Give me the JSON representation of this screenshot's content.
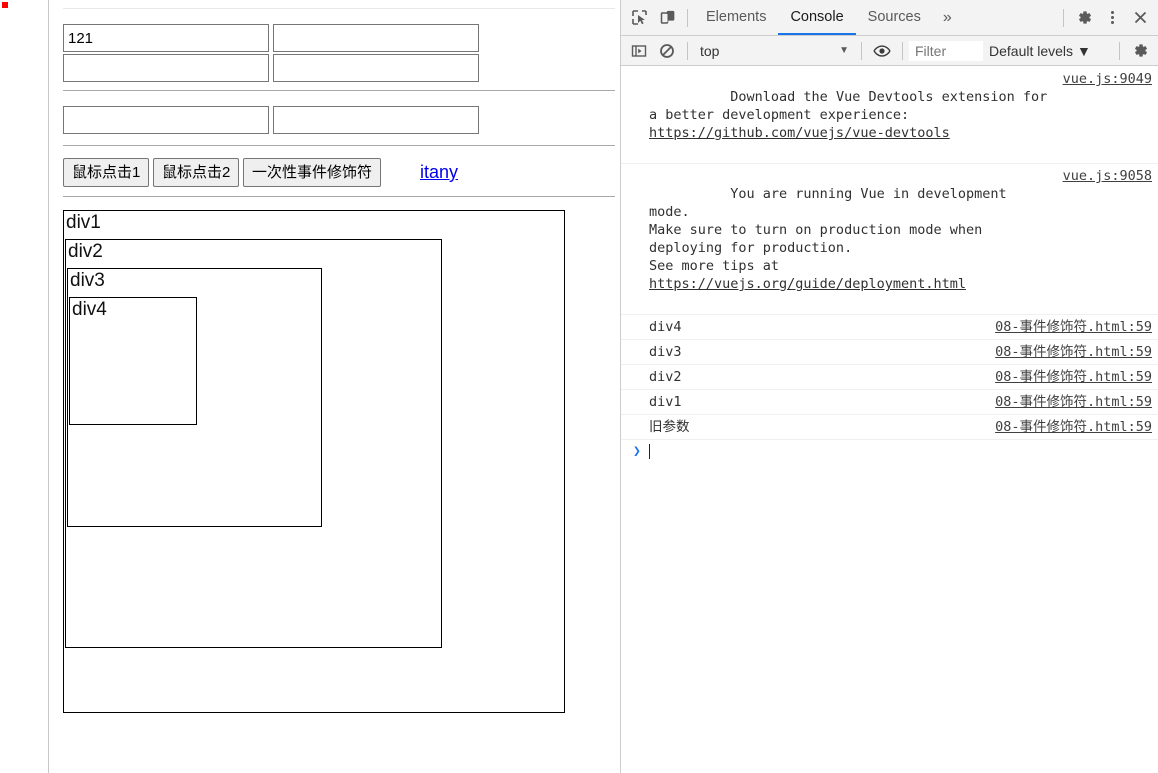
{
  "page": {
    "inputs": [
      {
        "name": "input-1",
        "value": "121",
        "placeholder": ""
      },
      {
        "name": "input-2",
        "value": "",
        "placeholder": ""
      },
      {
        "name": "input-3",
        "value": "",
        "placeholder": ""
      },
      {
        "name": "input-4",
        "value": "",
        "placeholder": ""
      },
      {
        "name": "input-5",
        "value": "",
        "placeholder": ""
      },
      {
        "name": "input-6",
        "value": "",
        "placeholder": ""
      }
    ],
    "buttons": [
      {
        "label": "鼠标点击1"
      },
      {
        "label": "鼠标点击2"
      },
      {
        "label": "一次性事件修饰符"
      }
    ],
    "link": {
      "label": "itany"
    },
    "boxes": [
      {
        "label": "div1"
      },
      {
        "label": "div2"
      },
      {
        "label": "div3"
      },
      {
        "label": "div4"
      }
    ]
  },
  "devtools": {
    "icons": {
      "inspect": "inspect-element-icon",
      "device": "device-toolbar-icon",
      "settings": "gear-icon",
      "more": "kebab-menu-icon",
      "close": "close-icon",
      "sidebar": "console-sidebar-icon",
      "clear": "clear-console-icon",
      "eye": "live-expression-eye-icon",
      "console_settings": "console-settings-gear-icon"
    },
    "tabs": [
      {
        "label": "Elements",
        "active": false
      },
      {
        "label": "Console",
        "active": true
      },
      {
        "label": "Sources",
        "active": false
      }
    ],
    "more_tabs_label": "»",
    "filter_bar": {
      "context_label": "top",
      "context_caret": "▼",
      "filter_placeholder": "Filter",
      "levels_label": "Default levels",
      "levels_caret": "▼"
    },
    "accent_color": "#1a73e8",
    "console_messages": [
      {
        "text_pre": "Download the Vue Devtools extension for a better development experience: ",
        "text_link": "https://github.com/vuejs/vue-devtools",
        "text_post": "",
        "source": "vue.js:9049"
      },
      {
        "text_pre": "You are running Vue in development mode.\nMake sure to turn on production mode when deploying for production.\nSee more tips at ",
        "text_link": "https://vuejs.org/guide/deployment.html",
        "text_post": "",
        "source": "vue.js:9058"
      },
      {
        "text_pre": "div4",
        "text_link": "",
        "text_post": "",
        "source": "08-事件修饰符.html:59"
      },
      {
        "text_pre": "div3",
        "text_link": "",
        "text_post": "",
        "source": "08-事件修饰符.html:59"
      },
      {
        "text_pre": "div2",
        "text_link": "",
        "text_post": "",
        "source": "08-事件修饰符.html:59"
      },
      {
        "text_pre": "div1",
        "text_link": "",
        "text_post": "",
        "source": "08-事件修饰符.html:59"
      },
      {
        "text_pre": "旧参数",
        "text_link": "",
        "text_post": "",
        "source": "08-事件修饰符.html:59"
      }
    ],
    "prompt": {
      "arrow": "❯",
      "value": ""
    }
  }
}
